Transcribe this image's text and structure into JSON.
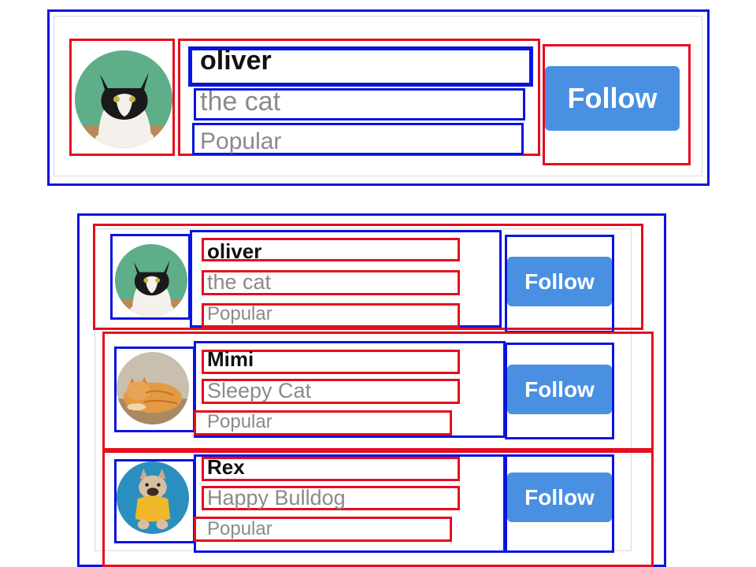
{
  "colors": {
    "annotation_blue": "#0a14e0",
    "annotation_red": "#e50d1f",
    "button_blue": "#4a90e2",
    "name_text": "#111111",
    "secondary_text": "#8a8a8a"
  },
  "single_card": {
    "name": "oliver",
    "subtitle": "the cat",
    "tag": "Popular",
    "button": "Follow",
    "avatar_icon": "tuxedo-cat-photo"
  },
  "list": [
    {
      "name": "oliver",
      "subtitle": "the cat",
      "tag": "Popular",
      "button": "Follow",
      "avatar_icon": "tuxedo-cat-photo"
    },
    {
      "name": "Mimi",
      "subtitle": "Sleepy Cat",
      "tag": "Popular",
      "button": "Follow",
      "avatar_icon": "orange-cat-photo"
    },
    {
      "name": "Rex",
      "subtitle": "Happy Bulldog",
      "tag": "Popular",
      "button": "Follow",
      "avatar_icon": "bulldog-photo"
    }
  ]
}
